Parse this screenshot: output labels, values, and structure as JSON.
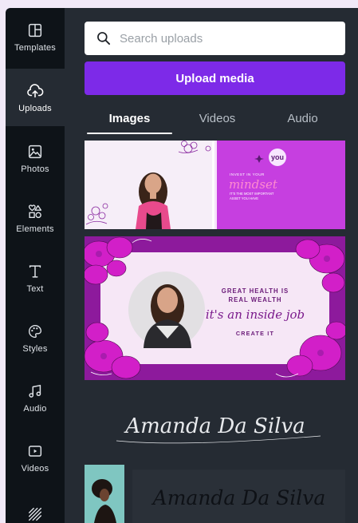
{
  "sidebar": {
    "items": [
      {
        "label": "Templates",
        "icon": "templates-icon"
      },
      {
        "label": "Uploads",
        "icon": "upload-cloud-icon",
        "active": true
      },
      {
        "label": "Photos",
        "icon": "photos-icon"
      },
      {
        "label": "Elements",
        "icon": "elements-icon"
      },
      {
        "label": "Text",
        "icon": "text-icon"
      },
      {
        "label": "Styles",
        "icon": "styles-palette-icon"
      },
      {
        "label": "Audio",
        "icon": "music-note-icon"
      },
      {
        "label": "Videos",
        "icon": "video-play-icon"
      },
      {
        "label": "",
        "icon": "pattern-icon"
      }
    ]
  },
  "search": {
    "placeholder": "Search uploads"
  },
  "upload_button": {
    "label": "Upload media"
  },
  "tabs": [
    {
      "label": "Images",
      "active": true
    },
    {
      "label": "Videos"
    },
    {
      "label": "Audio"
    }
  ],
  "uploads": {
    "thumb1": {
      "badge": "you",
      "line1": "INVEST IN YOUR",
      "script": "mindset",
      "line2": "IT'S THE MOST IMPORTANT",
      "line3": "ASSET YOU HAVE"
    },
    "thumb2": {
      "line1": "GREAT HEALTH IS",
      "line2": "REAL WEALTH",
      "script": "it's an inside job",
      "cta": "CREATE IT"
    },
    "signature1": "Amanda Da Silva",
    "signature2": "Amanda Da Silva"
  },
  "colors": {
    "accent": "#7d2ae8",
    "sidebar_bg": "#0e1318",
    "panel_bg": "#252b33",
    "magenta": "#d21fc8",
    "purple": "#8a1aa0"
  }
}
